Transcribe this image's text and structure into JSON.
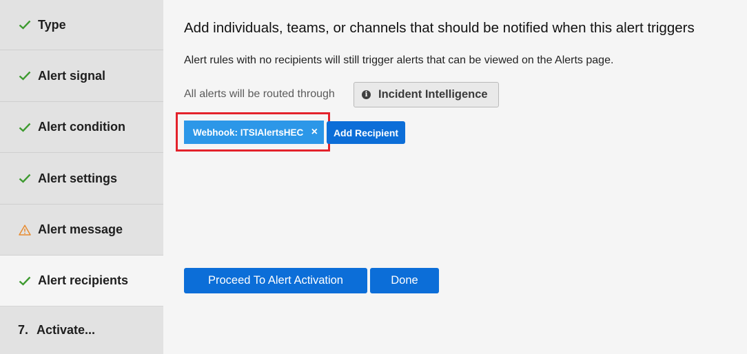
{
  "sidebar": {
    "steps": [
      {
        "label": "Type",
        "status": "complete",
        "icon": "check-icon"
      },
      {
        "label": "Alert signal",
        "status": "complete",
        "icon": "check-icon"
      },
      {
        "label": "Alert condition",
        "status": "complete",
        "icon": "check-icon"
      },
      {
        "label": "Alert settings",
        "status": "complete",
        "icon": "check-icon"
      },
      {
        "label": "Alert message",
        "status": "warning",
        "icon": "warning-icon"
      },
      {
        "label": "Alert recipients",
        "status": "complete-active",
        "icon": "check-icon"
      },
      {
        "label": "Activate...",
        "status": "pending",
        "number": "7."
      }
    ]
  },
  "main": {
    "title": "Add individuals, teams, or channels that should be notified when this alert triggers",
    "info": "Alert rules with no recipients will still trigger alerts that can be viewed on the Alerts page.",
    "route_label": "All alerts will be routed through",
    "integration_label": "Incident Intelligence",
    "recipient_chip": "Webhook: ITSIAlertsHEC",
    "recipient_remove": "×",
    "add_recipient": "Add Recipient",
    "proceed_button": "Proceed To Alert Activation",
    "done_button": "Done"
  },
  "colors": {
    "check": "#3d9a2f",
    "warning": "#e88b2e",
    "primary": "#0c6ed8",
    "chip": "#2c97e8",
    "highlight": "#e3222b"
  }
}
